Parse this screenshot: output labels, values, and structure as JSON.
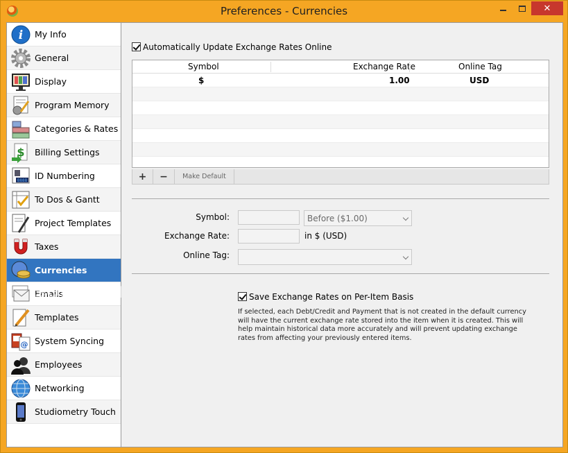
{
  "window": {
    "title": "Preferences - Currencies",
    "close_glyph": "✕"
  },
  "sidebar": {
    "items": [
      {
        "label": "My Info",
        "icon": "info-icon"
      },
      {
        "label": "General",
        "icon": "gear-icon"
      },
      {
        "label": "Display",
        "icon": "monitor-icon"
      },
      {
        "label": "Program Memory",
        "icon": "memory-icon"
      },
      {
        "label": "Categories & Rates",
        "icon": "categories-icon"
      },
      {
        "label": "Billing Settings",
        "icon": "billing-icon"
      },
      {
        "label": "ID Numbering",
        "icon": "id-card-icon"
      },
      {
        "label": "To Dos & Gantt",
        "icon": "todo-icon"
      },
      {
        "label": "Project Templates",
        "icon": "project-templates-icon"
      },
      {
        "label": "Taxes",
        "icon": "magnet-icon"
      },
      {
        "label": "Currencies",
        "icon": "currency-icon",
        "selected": true
      },
      {
        "label": "Emails",
        "icon": "envelope-icon"
      },
      {
        "label": "Templates",
        "icon": "pencil-icon"
      },
      {
        "label": "System Syncing",
        "icon": "sync-icon"
      },
      {
        "label": "Employees",
        "icon": "employees-icon"
      },
      {
        "label": "Networking",
        "icon": "globe-icon"
      },
      {
        "label": "Studiometry Touch",
        "icon": "phone-icon"
      }
    ],
    "watermark": "SOFTPEDIA"
  },
  "main": {
    "auto_update_label": "Automatically Update Exchange Rates Online",
    "auto_update_checked": true,
    "table": {
      "columns": [
        "Symbol",
        "Exchange Rate",
        "Online Tag"
      ],
      "rows": [
        {
          "symbol": "$",
          "rate": "1.00",
          "tag": "USD"
        }
      ]
    },
    "toolbar": {
      "add_label": "+",
      "remove_label": "−",
      "make_default_label": "Make Default"
    },
    "form": {
      "symbol_label": "Symbol:",
      "symbol_value": "",
      "position_value": "Before ($1.00)",
      "rate_label": "Exchange Rate:",
      "rate_value": "",
      "rate_unit": "in $ (USD)",
      "tag_label": "Online Tag:",
      "tag_value": ""
    },
    "save_rates_label": "Save Exchange Rates on Per-Item Basis",
    "save_rates_checked": true,
    "help_text": "If selected, each Debt/Credit and Payment that is not created in the default currency will have the current exchange rate stored into the item when it is created. This will help maintain historical data more accurately and will prevent updating exchange rates from affecting your previously entered items."
  }
}
